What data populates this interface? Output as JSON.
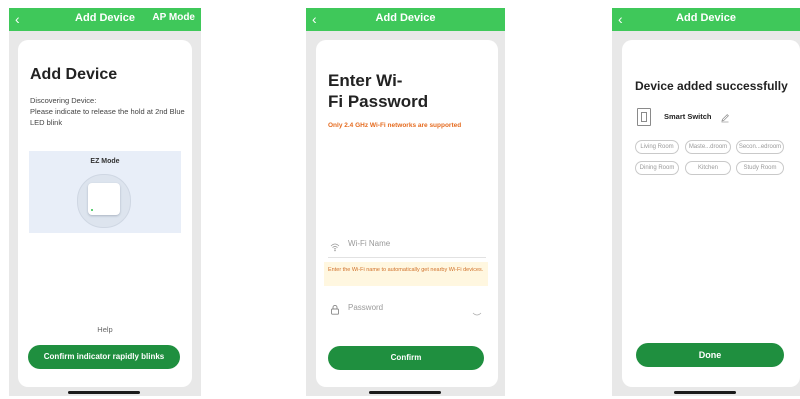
{
  "colors": {
    "accent": "#3fc85a",
    "button": "#1f8f3f",
    "warning_text": "#e56b1f",
    "hint_bg": "#fff7e0"
  },
  "screen1": {
    "title": "Add Device",
    "ap_mode": "AP Mode",
    "heading": "Add Device",
    "discovering": "Discovering Device:",
    "instructions": "Please indicate to release the hold at 2nd Blue LED blink",
    "ez_mode": "EZ Mode",
    "help": "Help",
    "confirm_button": "Confirm indicator rapidly blinks"
  },
  "screen2": {
    "title": "Add Device",
    "heading_line1": "Enter Wi-",
    "heading_line2": "Fi Password",
    "warning": "Only 2.4 GHz Wi-Fi networks are supported",
    "wifi_placeholder": "Wi-Fi Name",
    "hint": "Enter the Wi-Fi name to automatically get nearby Wi-Fi devices.",
    "password_placeholder": "Password",
    "confirm_button": "Confirm"
  },
  "screen3": {
    "title": "Add Device",
    "heading": "Device added successfully",
    "device_name": "Smart Switch",
    "rooms": [
      "Living Room",
      "Maste...droom",
      "Secon...edroom",
      "Dining Room",
      "Kitchen",
      "Study Room"
    ],
    "done_button": "Done"
  }
}
